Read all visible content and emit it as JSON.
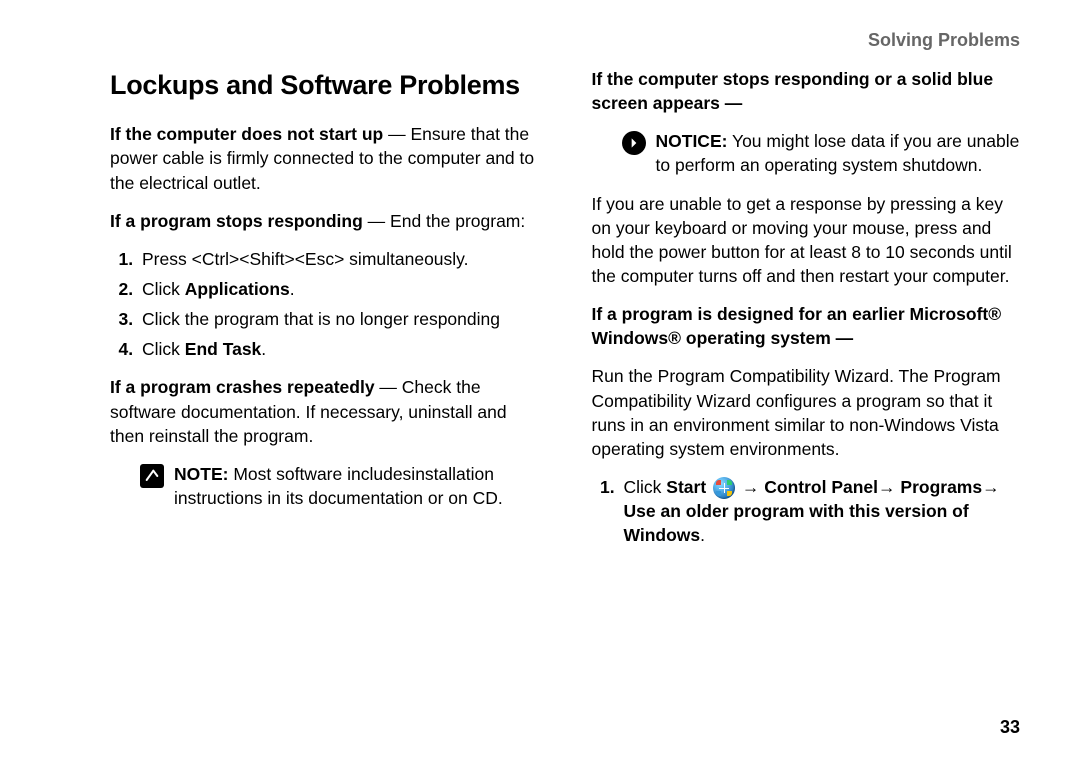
{
  "header": {
    "section": "Solving Problems"
  },
  "title": "Lockups and Software Problems",
  "left": {
    "p1_bold": "If the computer does not start up",
    "p1_rest": " — Ensure that the power cable is firmly connected to the computer and to the electrical outlet.",
    "p2_bold": "If a program stops responding",
    "p2_rest": " — End the program:",
    "list": {
      "i1": "Press <Ctrl><Shift><Esc> simultaneously.",
      "i2a": "Click ",
      "i2b": "Applications",
      "i2c": ".",
      "i3": "Click the program that is no longer responding",
      "i4a": "Click ",
      "i4b": "End Task",
      "i4c": "."
    },
    "p3_bold": "If a program crashes repeatedly",
    "p3_rest": " — Check the software documentation. If necessary, uninstall and then reinstall the program.",
    "note_label": "NOTE:",
    "note_text": " Most software includesinstallation instructions in its documentation or on CD."
  },
  "right": {
    "h1_bold": "If the computer stops responding or a solid blue screen appears —",
    "notice_label": "NOTICE:",
    "notice_text": " You might lose data if you are unable to perform an operating system shutdown.",
    "p1": "If you are unable to get a response by pressing a key on your keyboard or moving your mouse, press and hold the power button for at least 8 to 10 seconds until the computer turns off and then restart your computer.",
    "h2_bold": "If a program is designed for an earlier Microsoft® Windows® operating system —",
    "p2": "Run the Program Compatibility Wizard. The Program Compatibility Wizard configures a program so that it runs in an environment similar to non-Windows Vista operating system environments.",
    "step1_a": "Click ",
    "step1_b": "Start",
    "step1_c": " → ",
    "step1_d": "Control Panel",
    "step1_e": "→ ",
    "step1_f": "Programs",
    "step1_g": "→ ",
    "step1_h": "Use an older program with this version of Windows",
    "step1_i": "."
  },
  "pagenum": "33"
}
